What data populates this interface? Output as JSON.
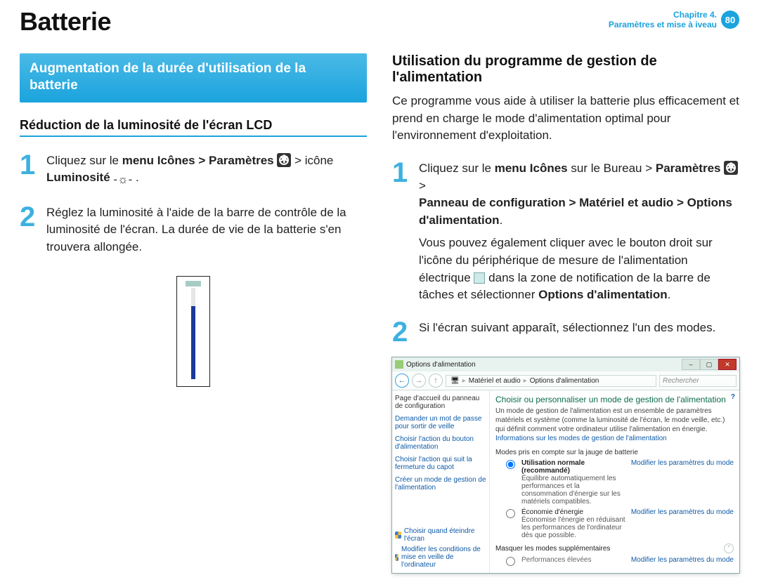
{
  "header": {
    "title": "Batterie",
    "chapter_line1": "Chapitre 4.",
    "chapter_line2": "Paramètres et mise à iveau",
    "page_number": "80"
  },
  "left": {
    "banner": "Augmentation de la durée d'utilisation de la batterie",
    "subhead": "Réduction de la luminosité de l'écran LCD",
    "step1_a": "Cliquez sur le ",
    "step1_b": "menu Icônes > Paramètres",
    "step1_c": " > icône ",
    "step1_d": "Luminosité",
    "step1_e": " .",
    "step2": "Réglez la luminosité à l'aide de la barre de contrôle de la luminosité de l'écran. La durée de vie de la batterie s'en trouvera allongée."
  },
  "right": {
    "subhead": "Utilisation du programme de gestion de l'alimentation",
    "intro": "Ce programme vous aide à utiliser la batterie plus efficacement et prend en charge le mode d'alimentation optimal pour l'environnement d'exploitation.",
    "step1_a": "Cliquez sur le ",
    "step1_b": "menu Icônes",
    "step1_c": " sur le Bureau > ",
    "step1_d": "Paramètres",
    "step1_e": " > ",
    "step1_f": "Panneau de configuration > Matériel et audio > Options d'alimentation",
    "step1_g": ".",
    "step1_p2a": "Vous pouvez également cliquer avec le bouton droit sur l'icône du périphérique de mesure de l'alimentation électrique ",
    "step1_p2b": " dans la zone de notification de la barre de tâches et sélectionner ",
    "step1_p2c": "Options d'alimentation",
    "step1_p2d": ".",
    "step2": "Si l'écran suivant apparaît, sélectionnez l'un des modes."
  },
  "dialog": {
    "title": "Options d'alimentation",
    "crumb_a": "Matériel et audio",
    "crumb_b": "Options d'alimentation",
    "search_ph": "Rechercher",
    "side_title": "Page d'accueil du panneau de configuration",
    "side_l1": "Demander un mot de passe pour sortir de veille",
    "side_l2": "Choisir l'action du bouton d'alimentation",
    "side_l3": "Choisir l'action qui suit la fermeture du capot",
    "side_l4": "Créer un mode de gestion de l'alimentation",
    "side_b1": "Choisir quand éteindre l'écran",
    "side_b2": "Modifier les conditions de mise en veille de l'ordinateur",
    "help": "?",
    "main_title": "Choisir ou personnaliser un mode de gestion de l'alimentation",
    "main_desc_a": "Un mode de gestion de l'alimentation est un ensemble de paramètres matériels et système (comme la luminosité de l'écran, le mode veille, etc.) qui définit comment votre ordinateur utilise l'alimentation en énergie. ",
    "main_desc_b": "Informations sur les modes de gestion de l'alimentation",
    "sub1": "Modes pris en compte sur la jauge de batterie",
    "plan1_name": "Utilisation normale (recommandé)",
    "plan1_sub": "Équilibre automatiquement les performances et la consommation d'énergie sur les matériels compatibles.",
    "plan2_name": "Économie d'énergie",
    "plan2_sub": "Économise l'énergie en réduisant les performances de l'ordinateur dès que possible.",
    "mod_link": "Modifier les paramètres du mode",
    "expand_label": "Masquer les modes supplémentaires",
    "plan3_name": "Performances élevées"
  }
}
